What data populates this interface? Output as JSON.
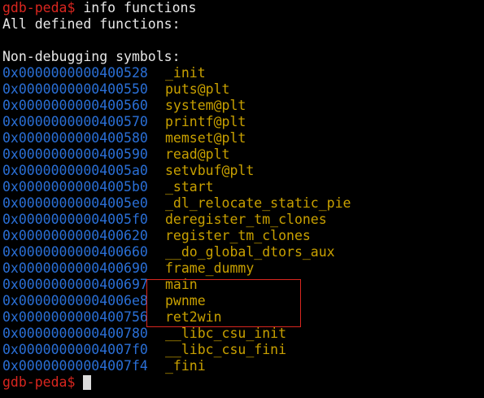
{
  "terminal": {
    "prompt": "gdb-peda$",
    "command": "info functions",
    "header": "All defined functions:",
    "section_title": "Non-debugging symbols:",
    "functions": [
      {
        "address": "0x0000000000400528",
        "name": "_init"
      },
      {
        "address": "0x0000000000400550",
        "name": "puts@plt"
      },
      {
        "address": "0x0000000000400560",
        "name": "system@plt"
      },
      {
        "address": "0x0000000000400570",
        "name": "printf@plt"
      },
      {
        "address": "0x0000000000400580",
        "name": "memset@plt"
      },
      {
        "address": "0x0000000000400590",
        "name": "read@plt"
      },
      {
        "address": "0x00000000004005a0",
        "name": "setvbuf@plt"
      },
      {
        "address": "0x00000000004005b0",
        "name": "_start"
      },
      {
        "address": "0x00000000004005e0",
        "name": "_dl_relocate_static_pie"
      },
      {
        "address": "0x00000000004005f0",
        "name": "deregister_tm_clones"
      },
      {
        "address": "0x0000000000400620",
        "name": "register_tm_clones"
      },
      {
        "address": "0x0000000000400660",
        "name": "__do_global_dtors_aux"
      },
      {
        "address": "0x0000000000400690",
        "name": "frame_dummy"
      },
      {
        "address": "0x0000000000400697",
        "name": "main"
      },
      {
        "address": "0x00000000004006e8",
        "name": "pwnme"
      },
      {
        "address": "0x0000000000400756",
        "name": "ret2win"
      },
      {
        "address": "0x0000000000400780",
        "name": "__libc_csu_init"
      },
      {
        "address": "0x00000000004007f0",
        "name": "__libc_csu_fini"
      },
      {
        "address": "0x00000000004007f4",
        "name": "_fini"
      }
    ],
    "final_prompt": "gdb-peda$",
    "colors": {
      "prompt": "#d9261f",
      "address": "#2a6fd6",
      "symbol": "#c8a000",
      "text": "#e8e8e8",
      "background": "#000000",
      "highlight_border": "#d9261f"
    }
  }
}
